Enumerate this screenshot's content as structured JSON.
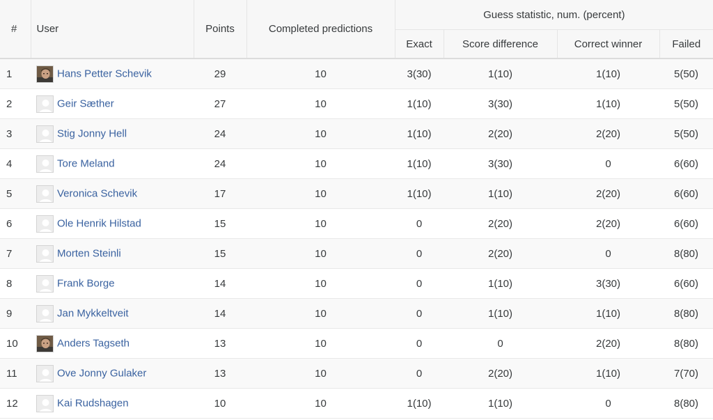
{
  "headers": {
    "rank": "#",
    "user": "User",
    "points": "Points",
    "completed": "Completed predictions",
    "group": "Guess statistic, num. (percent)",
    "exact": "Exact",
    "score_diff": "Score difference",
    "correct_winner": "Correct winner",
    "failed": "Failed"
  },
  "rows": [
    {
      "rank": "1",
      "name": "Hans Petter Schevik",
      "avatar": "photo",
      "points": "29",
      "completed": "10",
      "exact": "3(30)",
      "score_diff": "1(10)",
      "correct_winner": "1(10)",
      "failed": "5(50)"
    },
    {
      "rank": "2",
      "name": "Geir Sæther",
      "avatar": "default",
      "points": "27",
      "completed": "10",
      "exact": "1(10)",
      "score_diff": "3(30)",
      "correct_winner": "1(10)",
      "failed": "5(50)"
    },
    {
      "rank": "3",
      "name": "Stig Jonny Hell",
      "avatar": "default",
      "points": "24",
      "completed": "10",
      "exact": "1(10)",
      "score_diff": "2(20)",
      "correct_winner": "2(20)",
      "failed": "5(50)"
    },
    {
      "rank": "4",
      "name": "Tore Meland",
      "avatar": "default",
      "points": "24",
      "completed": "10",
      "exact": "1(10)",
      "score_diff": "3(30)",
      "correct_winner": "0",
      "failed": "6(60)"
    },
    {
      "rank": "5",
      "name": "Veronica Schevik",
      "avatar": "default",
      "points": "17",
      "completed": "10",
      "exact": "1(10)",
      "score_diff": "1(10)",
      "correct_winner": "2(20)",
      "failed": "6(60)"
    },
    {
      "rank": "6",
      "name": "Ole Henrik Hilstad",
      "avatar": "default",
      "points": "15",
      "completed": "10",
      "exact": "0",
      "score_diff": "2(20)",
      "correct_winner": "2(20)",
      "failed": "6(60)"
    },
    {
      "rank": "7",
      "name": "Morten Steinli",
      "avatar": "default",
      "points": "15",
      "completed": "10",
      "exact": "0",
      "score_diff": "2(20)",
      "correct_winner": "0",
      "failed": "8(80)"
    },
    {
      "rank": "8",
      "name": "Frank Borge",
      "avatar": "default",
      "points": "14",
      "completed": "10",
      "exact": "0",
      "score_diff": "1(10)",
      "correct_winner": "3(30)",
      "failed": "6(60)"
    },
    {
      "rank": "9",
      "name": "Jan Mykkeltveit",
      "avatar": "default",
      "points": "14",
      "completed": "10",
      "exact": "0",
      "score_diff": "1(10)",
      "correct_winner": "1(10)",
      "failed": "8(80)"
    },
    {
      "rank": "10",
      "name": "Anders Tagseth",
      "avatar": "photo",
      "points": "13",
      "completed": "10",
      "exact": "0",
      "score_diff": "0",
      "correct_winner": "2(20)",
      "failed": "8(80)"
    },
    {
      "rank": "11",
      "name": "Ove Jonny Gulaker",
      "avatar": "default",
      "points": "13",
      "completed": "10",
      "exact": "0",
      "score_diff": "2(20)",
      "correct_winner": "1(10)",
      "failed": "7(70)"
    },
    {
      "rank": "12",
      "name": "Kai Rudshagen",
      "avatar": "default",
      "points": "10",
      "completed": "10",
      "exact": "1(10)",
      "score_diff": "1(10)",
      "correct_winner": "0",
      "failed": "8(80)"
    }
  ],
  "colors": {
    "link": "#3a62a0",
    "text": "#373a3c",
    "header_bg": "#f7f7f7",
    "stripe": "#f9f9f9"
  }
}
